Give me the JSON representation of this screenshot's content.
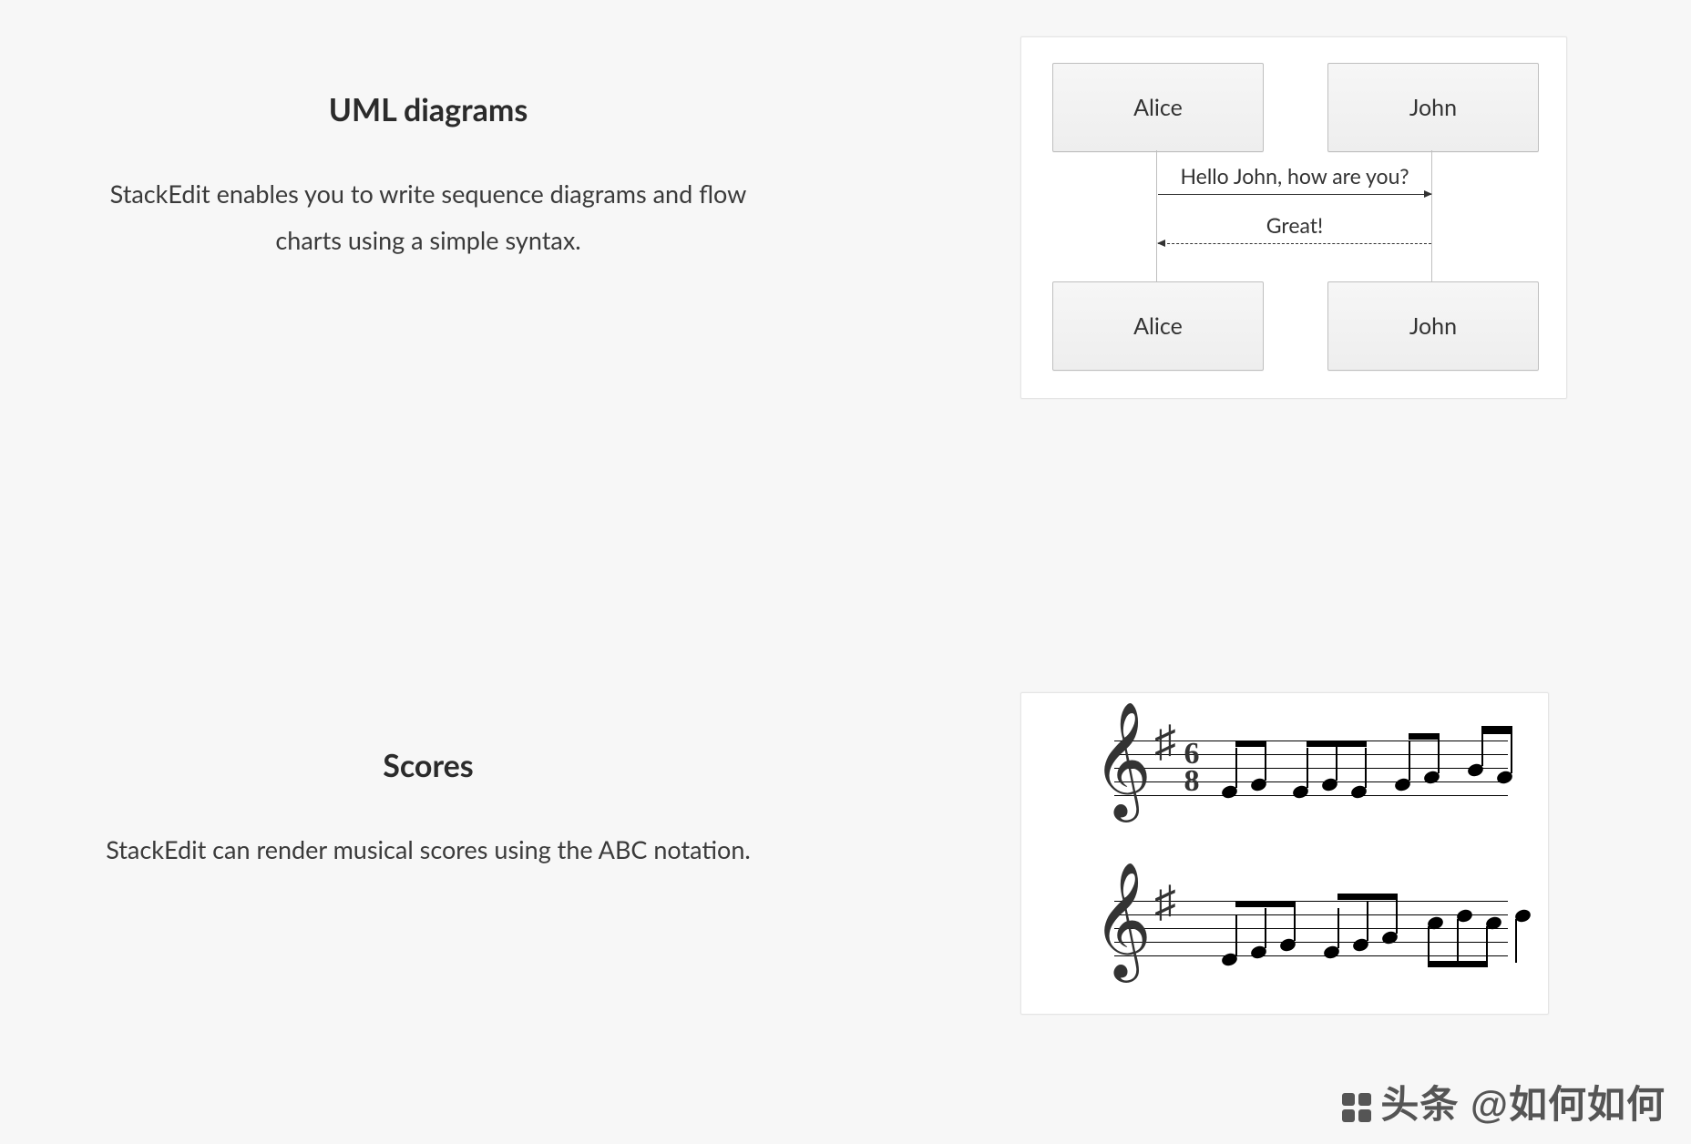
{
  "sections": {
    "uml": {
      "title": "UML diagrams",
      "body": "StackEdit enables you to write sequence diagrams and flow charts using a simple syntax.",
      "diagram": {
        "participants": [
          "Alice",
          "John"
        ],
        "messages": [
          {
            "from": "Alice",
            "to": "John",
            "text": "Hello John, how are you?",
            "style": "solid"
          },
          {
            "from": "John",
            "to": "Alice",
            "text": "Great!",
            "style": "dashed"
          }
        ]
      }
    },
    "scores": {
      "title": "Scores",
      "body": "StackEdit can render musical scores using the ABC notation.",
      "score": {
        "clef": "treble",
        "key_signature": "1 sharp",
        "time_signature": {
          "top": "6",
          "bottom": "8"
        },
        "staves": 2
      }
    }
  },
  "watermark": "头条 @如何如何"
}
